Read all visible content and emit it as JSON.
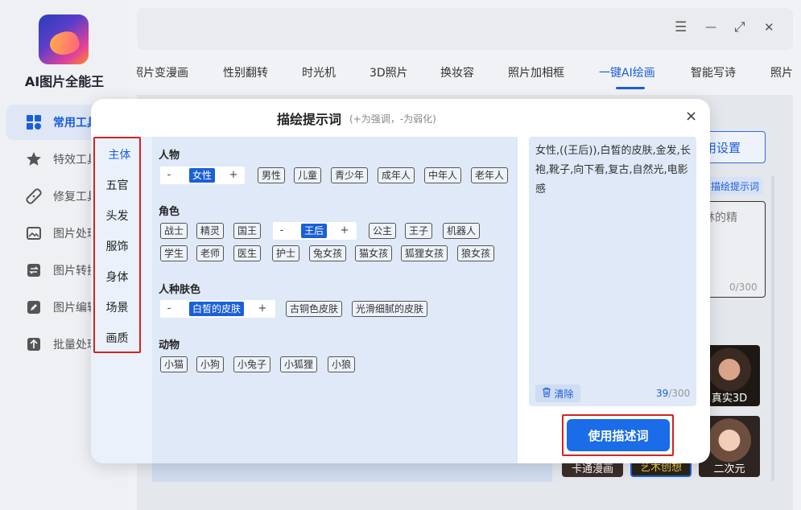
{
  "app": {
    "title": "AI图片全能王"
  },
  "sidebar": {
    "items": [
      {
        "label": "常用工具",
        "icon": "grid-icon"
      },
      {
        "label": "特效工具",
        "icon": "star-icon"
      },
      {
        "label": "修复工具",
        "icon": "bandage-icon"
      },
      {
        "label": "图片处理",
        "icon": "image-icon"
      },
      {
        "label": "图片转换",
        "icon": "convert-icon"
      },
      {
        "label": "图片编辑",
        "icon": "edit-icon"
      },
      {
        "label": "批量处理",
        "icon": "upload-icon"
      }
    ]
  },
  "window": {
    "menu": "☰",
    "minimize": "—",
    "maximize": "⤢",
    "close": "✕"
  },
  "tabs": [
    "照片变漫画",
    "性别翻转",
    "时光机",
    "3D照片",
    "换妆容",
    "照片加相框",
    "一键AI绘画",
    "智能写诗",
    "照片"
  ],
  "background": {
    "settings_label": "用设置",
    "prompt_tag": "描绘提示词",
    "textarea_text": "林的精",
    "textarea_count": "0/300",
    "styles": [
      "真实3D",
      "卡通漫画",
      "艺术创想",
      "二次元"
    ]
  },
  "modal": {
    "title": "描绘提示词",
    "subtitle": "(+为强调，-为弱化)",
    "close": "×",
    "categories": [
      "主体",
      "五官",
      "头发",
      "服饰",
      "身体",
      "场景",
      "画质"
    ],
    "sections": {
      "person": {
        "title": "人物",
        "selected": "女性",
        "tags": [
          "男性",
          "儿童",
          "青少年",
          "成年人",
          "中年人",
          "老年人"
        ]
      },
      "role": {
        "title": "角色",
        "tags_before": [
          "战士",
          "精灵",
          "国王"
        ],
        "selected": "王后",
        "tags_after": [
          "公主",
          "王子",
          "机器人"
        ],
        "row2": [
          "学生",
          "老师",
          "医生",
          "护士",
          "兔女孩",
          "猫女孩",
          "狐狸女孩",
          "狼女孩"
        ]
      },
      "skin": {
        "title": "人种肤色",
        "selected": "白皙的皮肤",
        "tags": [
          "古铜色皮肤",
          "光滑细腻的皮肤"
        ]
      },
      "animal": {
        "title": "动物",
        "tags": [
          "小猫",
          "小狗",
          "小兔子",
          "小狐狸",
          "小狼"
        ]
      }
    },
    "stepper": {
      "minus": "-",
      "plus": "+"
    },
    "prompt": {
      "text": "女性,((王后)),白皙的皮肤,金发,长袍,靴子,向下看,复古,自然光,电影感",
      "clear_label": "清除",
      "count": "39",
      "max": "/300"
    },
    "use_button": "使用描述词"
  },
  "colors": {
    "accent": "#1a5fd8",
    "highlight_box": "#d62222"
  }
}
